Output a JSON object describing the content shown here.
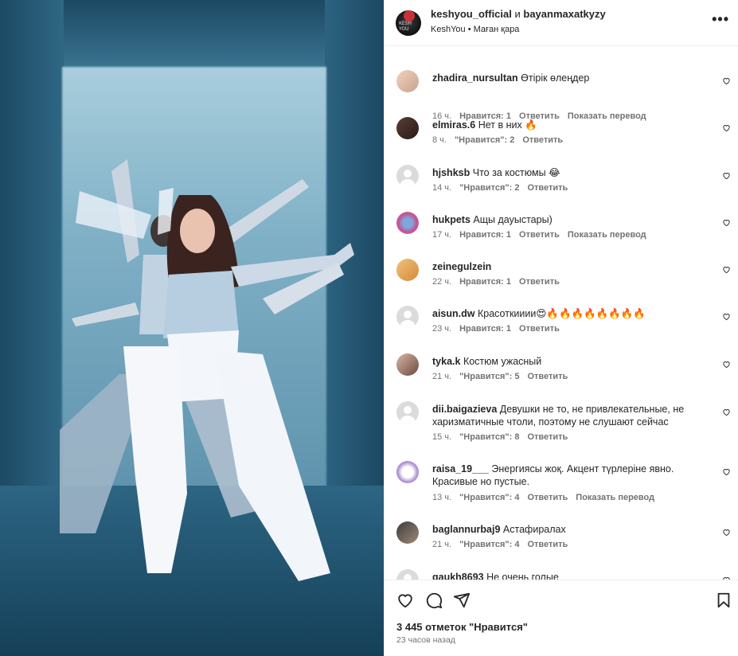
{
  "header": {
    "user1": "keshyou_official",
    "and": "и",
    "user2": "bayanmaxatkyzy",
    "subtitle": "KeshYou • Маған қара",
    "avatar_text": "KESH YOU",
    "more_icon": "more-horizontal-icon"
  },
  "comments": [
    {
      "user": "zhadira_nursultan",
      "text": "Өтірік өлеңдер",
      "time": "16 ч.",
      "likes": "Нравится: 1",
      "reply": "Ответить",
      "translate": "Показать перевод",
      "avatar": "photo"
    },
    {
      "user": "elmiras.6",
      "text": "Нет в них 🔥",
      "time": "8 ч.",
      "likes": "\"Нравится\": 2",
      "reply": "Ответить",
      "translate": "",
      "avatar": "photo"
    },
    {
      "user": "hjshksb",
      "text": "Что за костюмы 😂",
      "time": "14 ч.",
      "likes": "\"Нравится\": 2",
      "reply": "Ответить",
      "translate": "",
      "avatar": "default"
    },
    {
      "user": "hukpets",
      "text": "Ащы дауыстары)",
      "time": "17 ч.",
      "likes": "Нравится: 1",
      "reply": "Ответить",
      "translate": "Показать перевод",
      "avatar": "photo"
    },
    {
      "user": "zeinegulzein",
      "text": "",
      "time": "22 ч.",
      "likes": "Нравится: 1",
      "reply": "Ответить",
      "translate": "",
      "avatar": "photo"
    },
    {
      "user": "aisun.dw",
      "text": "Красоткииии😍🔥🔥🔥🔥🔥🔥🔥🔥",
      "time": "23 ч.",
      "likes": "Нравится: 1",
      "reply": "Ответить",
      "translate": "",
      "avatar": "default"
    },
    {
      "user": "tyka.k",
      "text": "Костюм ужасный",
      "time": "21 ч.",
      "likes": "\"Нравится\": 5",
      "reply": "Ответить",
      "translate": "",
      "avatar": "photo"
    },
    {
      "user": "dii.baigazieva",
      "text": "Девушки не то, не привлекательные, не харизматичные чтоли, поэтому не слушают сейчас",
      "time": "15 ч.",
      "likes": "\"Нравится\": 8",
      "reply": "Ответить",
      "translate": "",
      "avatar": "default"
    },
    {
      "user": "raisa_19___",
      "text": "Энергиясы жоқ. Акцент түрлеріне явно. Красивые но пустые.",
      "time": "13 ч.",
      "likes": "\"Нравится\": 4",
      "reply": "Ответить",
      "translate": "Показать перевод",
      "avatar": "photo"
    },
    {
      "user": "baglannurbaj9",
      "text": "Астафиралах",
      "time": "21 ч.",
      "likes": "\"Нравится\": 4",
      "reply": "Ответить",
      "translate": "",
      "avatar": "photo"
    },
    {
      "user": "gaukh8693",
      "text": "Не очень голые",
      "time": "",
      "likes": "",
      "reply": "",
      "translate": "",
      "avatar": "default"
    }
  ],
  "actions": {
    "like_icon": "heart-icon",
    "comment_icon": "comment-icon",
    "share_icon": "send-icon",
    "save_icon": "bookmark-icon",
    "likes_text": "3 445 отметок \"Нравится\"",
    "posted_time": "23 часов назад"
  },
  "colors": {
    "text": "#262626",
    "meta": "#737373",
    "border": "#efefef"
  }
}
